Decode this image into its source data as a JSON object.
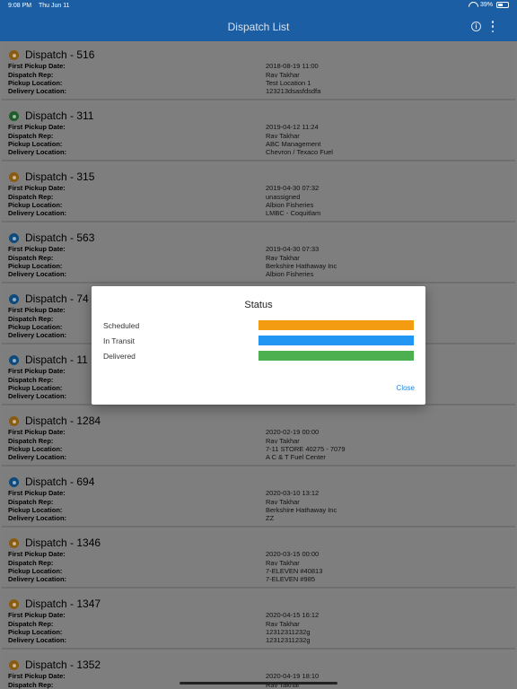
{
  "status_bar": {
    "time": "9:08 PM",
    "date": "Thu Jun 11",
    "battery": "39%"
  },
  "app_bar": {
    "title": "Dispatch List"
  },
  "labels": {
    "first_pickup": "First Pickup Date:",
    "rep": "Dispatch Rep:",
    "pickup_location": "Pickup Location:",
    "delivery_location": "Delivery Location:"
  },
  "dispatches": [
    {
      "title": "Dispatch - 516",
      "status": "scheduled",
      "date": "2018-08-19 11:00",
      "rep": "Rav Takhar",
      "pickup": "Test Location 1",
      "delivery": "123213dsasfdsdfa"
    },
    {
      "title": "Dispatch - 311",
      "status": "delivered",
      "date": "2019-04-12 11:24",
      "rep": "Rav Takhar",
      "pickup": "ABC Management",
      "delivery": "Chevron / Texaco Fuel"
    },
    {
      "title": "Dispatch - 315",
      "status": "scheduled",
      "date": "2019-04-30 07:32",
      "rep": "unassigned",
      "pickup": "Albion Fisheries",
      "delivery": "LMBC - Coquitlam"
    },
    {
      "title": "Dispatch - 563",
      "status": "intransit",
      "date": "2019-04-30 07:33",
      "rep": "Rav Takhar",
      "pickup": "Berkshire Hathaway Inc",
      "delivery": "Albion Fisheries"
    },
    {
      "title": "Dispatch - 74",
      "status": "intransit",
      "date": "",
      "rep": "",
      "pickup": "",
      "delivery": ""
    },
    {
      "title": "Dispatch - 11",
      "status": "intransit",
      "date": "",
      "rep": "",
      "pickup": "",
      "delivery": ""
    },
    {
      "title": "Dispatch - 1284",
      "status": "scheduled",
      "date": "2020-02-19 00:00",
      "rep": "Rav Takhar",
      "pickup": "7-11 STORE 40275 - 7079",
      "delivery": "A C & T  Fuel Center"
    },
    {
      "title": "Dispatch - 694",
      "status": "intransit",
      "date": "2020-03-10 13:12",
      "rep": "Rav Takhar",
      "pickup": "Berkshire Hathaway Inc",
      "delivery": "ZZ"
    },
    {
      "title": "Dispatch - 1346",
      "status": "scheduled",
      "date": "2020-03-15 00:00",
      "rep": "Rav Takhar",
      "pickup": "7-ELEVEN #40813",
      "delivery": "7-ELEVEN #985"
    },
    {
      "title": "Dispatch - 1347",
      "status": "scheduled",
      "date": "2020-04-15 16:12",
      "rep": "Rav Takhar",
      "pickup": "12312311232g",
      "delivery": "12312311232g"
    },
    {
      "title": "Dispatch - 1352",
      "status": "scheduled",
      "date": "2020-04-19 18:10",
      "rep": "Rav Takhar",
      "pickup": "",
      "delivery": ""
    }
  ],
  "dialog": {
    "title": "Status",
    "legend": [
      {
        "label": "Scheduled",
        "color": "#f39c12"
      },
      {
        "label": "In Transit",
        "color": "#2196f3"
      },
      {
        "label": "Delivered",
        "color": "#4caf50"
      }
    ],
    "close_label": "Close"
  }
}
